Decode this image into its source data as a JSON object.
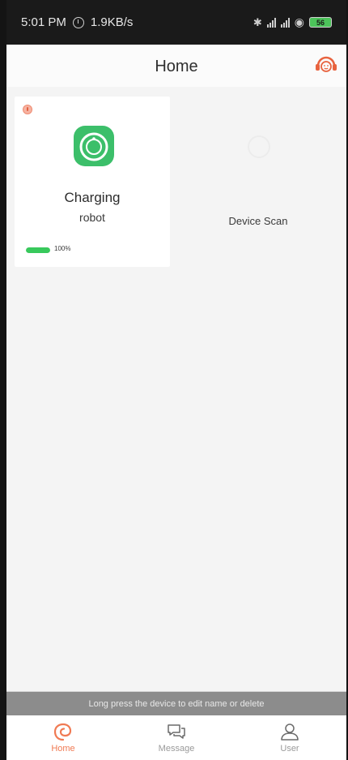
{
  "status_bar": {
    "time": "5:01 PM",
    "speed": "1.9KB/s",
    "battery": "56"
  },
  "header": {
    "title": "Home"
  },
  "device": {
    "status": "Charging",
    "name": "robot",
    "battery_percent": 100,
    "battery_label": "100%"
  },
  "scan": {
    "label": "Device Scan"
  },
  "notice": {
    "text": "Long press the device to edit name or delete"
  },
  "nav": {
    "items": [
      {
        "label": "Home",
        "icon": "home-swirl-icon",
        "active": true
      },
      {
        "label": "Message",
        "icon": "chat-icon",
        "active": false
      },
      {
        "label": "User",
        "icon": "user-icon",
        "active": false
      }
    ]
  },
  "colors": {
    "accent": "#f07a53",
    "robot_green": "#3cbf6a",
    "battery_green": "#38c95c"
  }
}
